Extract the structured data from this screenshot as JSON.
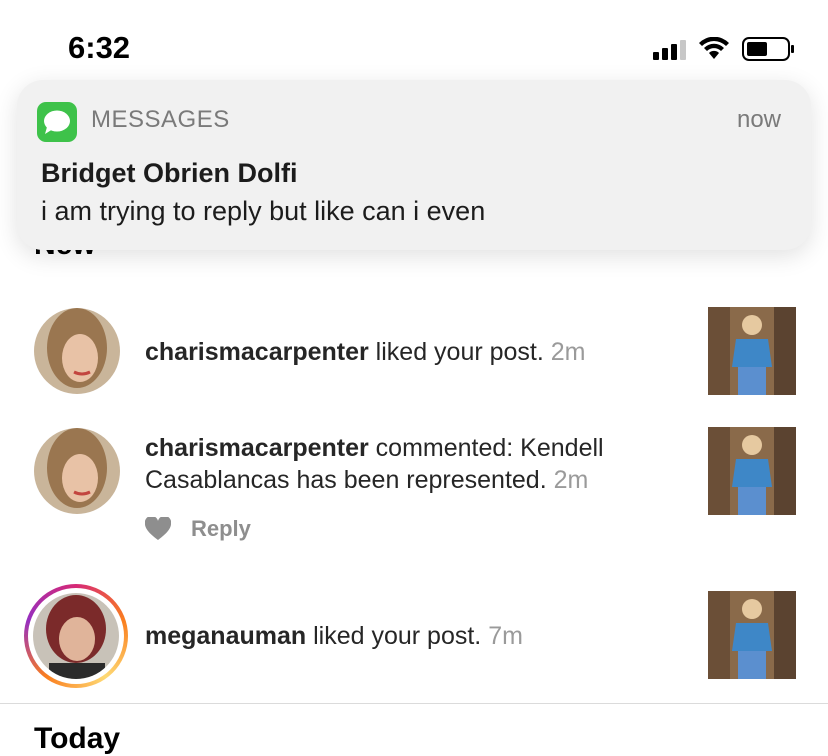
{
  "status_bar": {
    "time": "6:32"
  },
  "notification": {
    "app_name": "MESSAGES",
    "time": "now",
    "sender": "Bridget Obrien Dolfi",
    "message": "i am trying to reply but like can i even"
  },
  "feed": {
    "section_new": "New",
    "section_today": "Today",
    "items": [
      {
        "username": "charismacarpenter",
        "action": " liked your post.",
        "time": "2m"
      },
      {
        "username": "charismacarpenter",
        "action": " commented: Kendell Casablancas has been represented.",
        "time": "2m",
        "reply_label": "Reply"
      },
      {
        "username": "meganauman",
        "action": " liked your post.",
        "time": "7m"
      }
    ]
  }
}
